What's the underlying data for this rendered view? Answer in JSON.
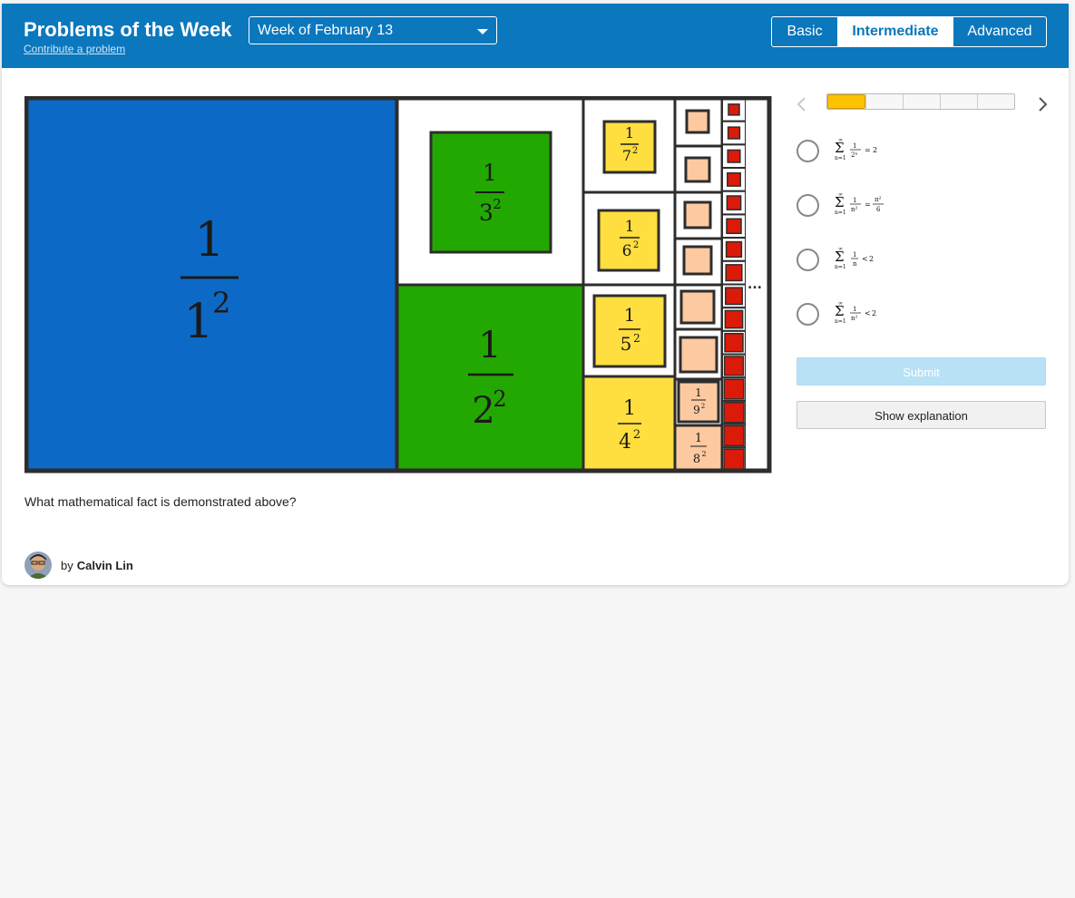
{
  "header": {
    "title": "Problems of the Week",
    "contribute_link": "Contribute a problem",
    "week_selected": "Week of February 13",
    "levels": [
      "Basic",
      "Intermediate",
      "Advanced"
    ],
    "active_level": "Intermediate"
  },
  "figure": {
    "labels": [
      {
        "num": "1",
        "den": "1",
        "exp": "2"
      },
      {
        "num": "1",
        "den": "3",
        "exp": "2"
      },
      {
        "num": "1",
        "den": "2",
        "exp": "2"
      },
      {
        "num": "1",
        "den": "7",
        "exp": "2"
      },
      {
        "num": "1",
        "den": "6",
        "exp": "2"
      },
      {
        "num": "1",
        "den": "5",
        "exp": "2"
      },
      {
        "num": "1",
        "den": "4",
        "exp": "2"
      },
      {
        "num": "1",
        "den": "9",
        "exp": "2"
      },
      {
        "num": "1",
        "den": "8",
        "exp": "2"
      }
    ],
    "ellipsis": "...",
    "colors": {
      "blue": "#0d69c6",
      "green": "#22a800",
      "yellow": "#ffde3f",
      "peach": "#fdc9a0",
      "red": "#dc1a0a",
      "outline": "#2d2d2d"
    }
  },
  "question": "What mathematical fact is demonstrated above?",
  "author": {
    "by": "by",
    "name": "Calvin Lin"
  },
  "progress": {
    "total_steps": 5,
    "current_step": 1,
    "fill_color": "#ffc200"
  },
  "options": [
    {
      "sum_top": "∞",
      "sum_bottom": "n=1",
      "num": "1",
      "den": "2ⁿ",
      "rel": "=",
      "rhs": "2"
    },
    {
      "sum_top": "∞",
      "sum_bottom": "n=1",
      "num": "1",
      "den": "n²",
      "rel": "=",
      "rhs_num": "π²",
      "rhs_den": "6"
    },
    {
      "sum_top": "∞",
      "sum_bottom": "n=1",
      "num": "1",
      "den": "n",
      "rel": "<",
      "rhs": "2"
    },
    {
      "sum_top": "∞",
      "sum_bottom": "n=1",
      "num": "1",
      "den": "n²",
      "rel": "<",
      "rhs": "2"
    }
  ],
  "buttons": {
    "submit": "Submit",
    "explanation": "Show explanation"
  }
}
